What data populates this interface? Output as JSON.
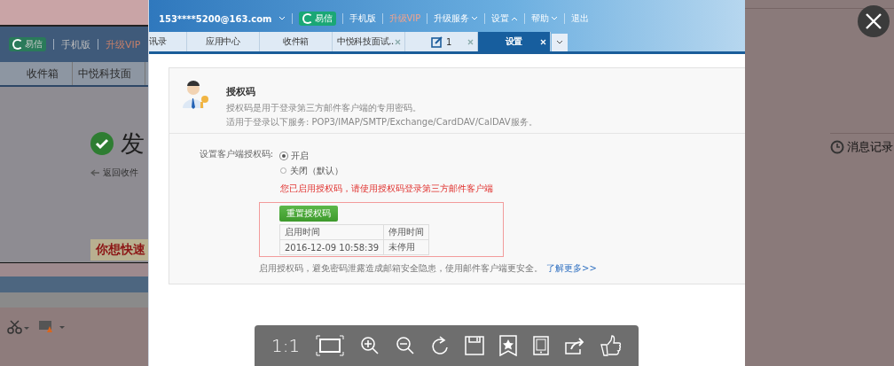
{
  "background_left": {
    "top_links": [
      {
        "kind": "badge",
        "label": "易信"
      },
      {
        "kind": "link",
        "label": "手机版"
      },
      {
        "kind": "vip",
        "label": "升级VIP"
      }
    ],
    "tabs": [
      "收件箱",
      "中悦科技面"
    ],
    "heading": "发",
    "back_link": "返回收件",
    "banner": "你想快速"
  },
  "background_right": {
    "history_link": "消息记录"
  },
  "header": {
    "account": "153****5200@163.com",
    "links": [
      {
        "kind": "badge",
        "label": "易信"
      },
      {
        "kind": "link",
        "label": "手机版"
      },
      {
        "kind": "vip",
        "label": "升级VIP"
      },
      {
        "kind": "menu",
        "label": "升级服务"
      },
      {
        "kind": "menu_up",
        "label": "设置"
      },
      {
        "kind": "menu",
        "label": "帮助"
      },
      {
        "kind": "link",
        "label": "退出"
      }
    ]
  },
  "tabs": [
    {
      "label": "讯录",
      "kind": "plain",
      "closable": false,
      "selected": false
    },
    {
      "label": "应用中心",
      "kind": "plain",
      "closable": false,
      "selected": false
    },
    {
      "label": "收件箱",
      "kind": "plain",
      "closable": false,
      "selected": false
    },
    {
      "label": "中悦科技面试..",
      "kind": "plain",
      "closable": true,
      "selected": false
    },
    {
      "label": "1",
      "kind": "compose",
      "closable": true,
      "selected": false
    },
    {
      "label": "设置",
      "kind": "plain",
      "closable": true,
      "selected": true
    }
  ],
  "auth_card": {
    "title": "授权码",
    "description": "授权码是用于登录第三方邮件客户端的专用密码。",
    "services": "适用于登录以下服务: POP3/IMAP/SMTP/Exchange/CardDAV/CalDAV服务。",
    "setting_label": "设置客户端授权码:",
    "options": [
      {
        "label": "开启",
        "selected": true
      },
      {
        "label": "关闭（默认）",
        "selected": false
      }
    ],
    "notice": "您已启用授权码，请使用授权码登录第三方邮件客户端",
    "reset_button": "重置授权码",
    "table": {
      "columns": [
        "启用时间",
        "停用时间"
      ],
      "rows": [
        [
          "2016-12-09 10:58:39",
          "未停用"
        ]
      ]
    },
    "footnote": "启用授权码，避免密码泄露造成邮箱安全隐患，使用邮件客户端更安全。",
    "learn_more": "了解更多>>"
  },
  "viewer_toolbar": [
    {
      "kind": "text",
      "label": "1:1"
    },
    {
      "kind": "fit"
    },
    {
      "kind": "zoom_in"
    },
    {
      "kind": "zoom_out"
    },
    {
      "kind": "rotate"
    },
    {
      "kind": "save"
    },
    {
      "kind": "bookmark"
    },
    {
      "kind": "tablet"
    },
    {
      "kind": "share"
    },
    {
      "kind": "like"
    }
  ]
}
